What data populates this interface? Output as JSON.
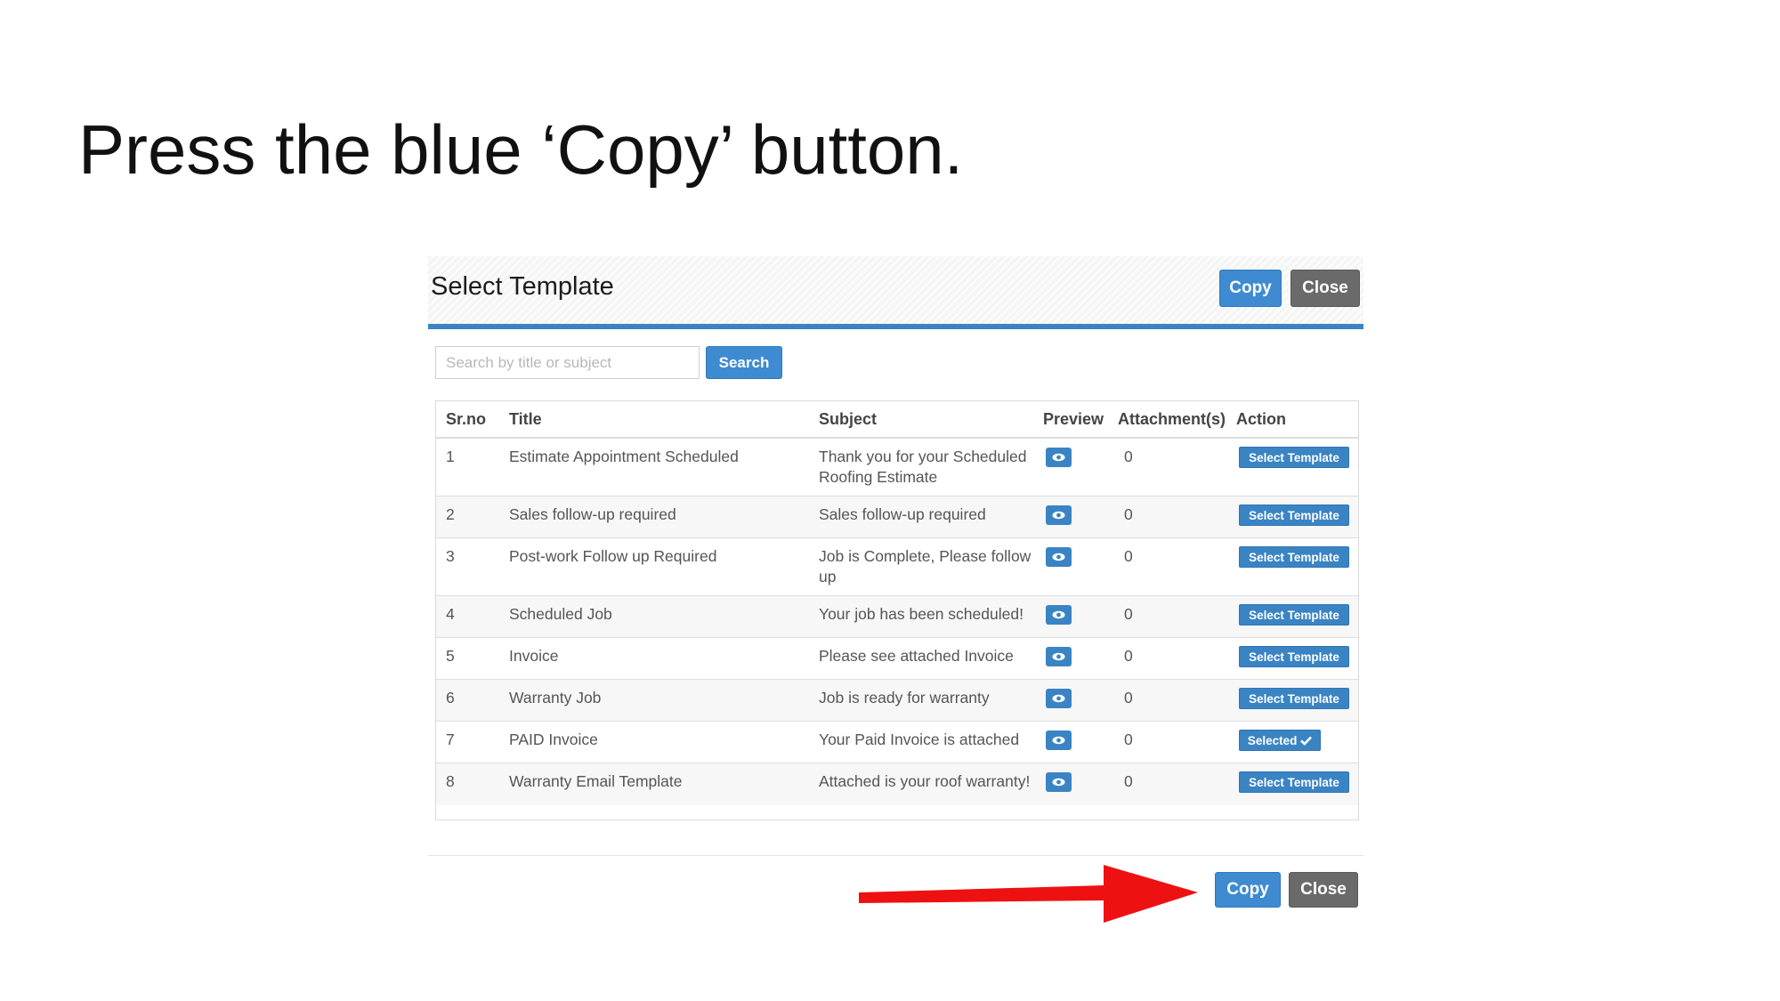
{
  "instruction": "Press the blue ‘Copy’ button.",
  "modal": {
    "title": "Select Template",
    "header_copy": "Copy",
    "header_close": "Close",
    "search_placeholder": "Search by title or subject",
    "search_button": "Search",
    "footer_copy": "Copy",
    "footer_close": "Close"
  },
  "table": {
    "headers": [
      "Sr.no",
      "Title",
      "Subject",
      "Preview",
      "Attachment(s)",
      "Action"
    ],
    "rows": [
      {
        "sr": "1",
        "title": "Estimate Appointment Scheduled",
        "subject": "Thank you for your Scheduled Roofing Estimate",
        "attachments": "0",
        "action": "Select Template"
      },
      {
        "sr": "2",
        "title": "Sales follow-up required",
        "subject": "Sales follow-up required",
        "attachments": "0",
        "action": "Select Template"
      },
      {
        "sr": "3",
        "title": "Post-work Follow up Required",
        "subject": "Job is Complete, Please follow up",
        "attachments": "0",
        "action": "Select Template"
      },
      {
        "sr": "4",
        "title": "Scheduled Job",
        "subject": "Your job has been scheduled!",
        "attachments": "0",
        "action": "Select Template"
      },
      {
        "sr": "5",
        "title": "Invoice",
        "subject": "Please see attached Invoice",
        "attachments": "0",
        "action": "Select Template"
      },
      {
        "sr": "6",
        "title": "Warranty Job",
        "subject": "Job is ready for warranty",
        "attachments": "0",
        "action": "Select Template"
      },
      {
        "sr": "7",
        "title": "PAID Invoice",
        "subject": "Your Paid Invoice is attached",
        "attachments": "0",
        "action": "Selected"
      },
      {
        "sr": "8",
        "title": "Warranty Email Template",
        "subject": "Attached is your roof warranty!",
        "attachments": "0",
        "action": "Select Template"
      }
    ]
  },
  "icons": {
    "preview": "eye-icon",
    "selected": "checkmark-icon",
    "annotation": "red-arrow"
  },
  "colors": {
    "primary_button": "#3f8bd2",
    "secondary_button": "#6a6a6a",
    "header_rule": "#3a84c4",
    "annotation_arrow": "#ee1111"
  }
}
